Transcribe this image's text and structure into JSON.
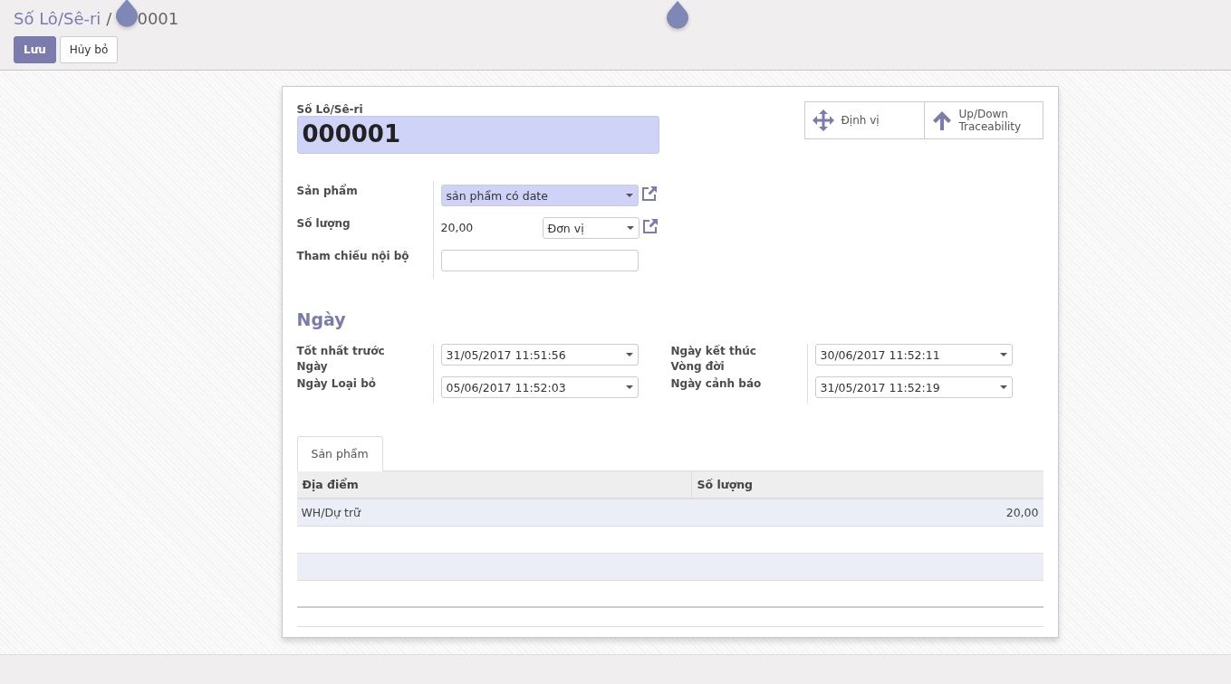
{
  "breadcrumb": {
    "parent": "Số Lô/Sê-ri",
    "separator": "/",
    "current": "0001"
  },
  "buttons": [
    {
      "label": "Lưu",
      "kind": "primary"
    },
    {
      "label": "Hủy bỏ",
      "kind": "default"
    }
  ],
  "smart_buttons": [
    {
      "label": "Định vị",
      "kind": "move"
    },
    {
      "label": "Up/Down Traceability",
      "kind": "up"
    }
  ],
  "title": {
    "label": "Số Lô/Sê-ri",
    "value": "000001"
  },
  "fields": [
    {
      "label": "Sản phẩm",
      "kind": "select",
      "value": "sản phẩm có date",
      "highlighted": true
    },
    {
      "label": "Số lượng",
      "kind": "quantity",
      "value": "20,00",
      "unit": "Đơn vị"
    },
    {
      "label": "Tham chiếu nội bộ",
      "kind": "text"
    }
  ],
  "section_title": "Ngày",
  "date_groups": [
    [
      {
        "label": "Tốt nhất trước Ngày",
        "value": "31/05/2017 11:51:56"
      },
      {
        "label": "Ngày Loại bỏ",
        "value": "05/06/2017 11:52:03"
      }
    ],
    [
      {
        "label": "Ngày kết thúc Vòng đời",
        "value": "30/06/2017 11:52:11"
      },
      {
        "label": "Ngày cảnh báo",
        "value": "31/05/2017 11:52:19"
      }
    ]
  ],
  "tabs": [
    {
      "label": "Sản phẩm",
      "selected": true
    }
  ],
  "table": {
    "columns": [
      "Địa điểm",
      "Số lượng"
    ],
    "rows": [
      [
        "WH/Dự trữ",
        "20,00"
      ]
    ]
  }
}
